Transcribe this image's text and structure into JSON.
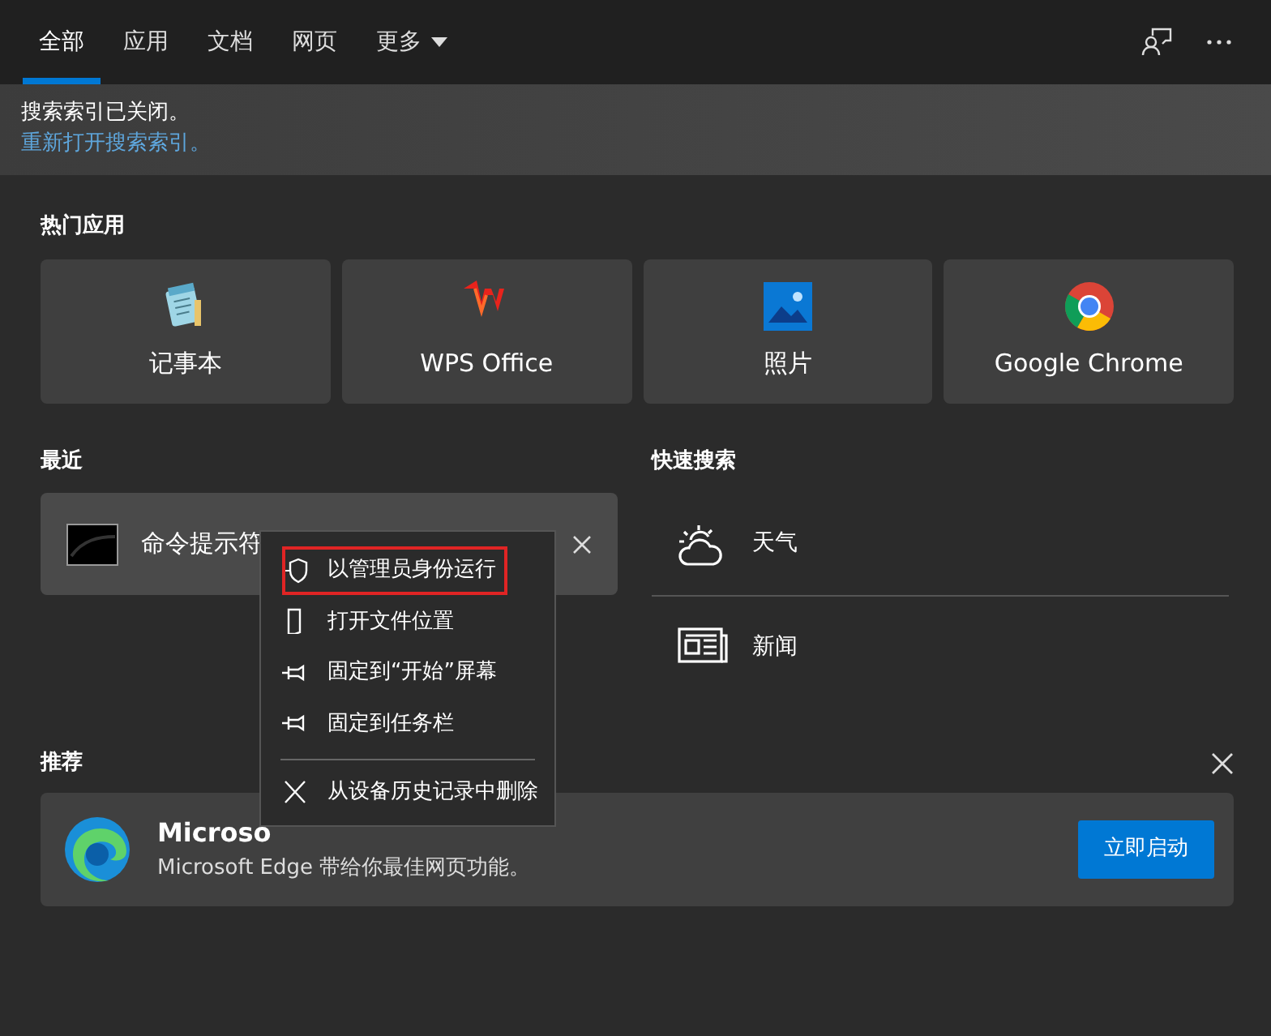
{
  "tabs": [
    {
      "label": "全部",
      "selected": true,
      "kind": "tab"
    },
    {
      "label": "应用",
      "selected": false,
      "kind": "tab"
    },
    {
      "label": "文档",
      "selected": false,
      "kind": "tab"
    },
    {
      "label": "网页",
      "selected": false,
      "kind": "tab"
    },
    {
      "label": "更多",
      "selected": false,
      "kind": "dropdown"
    }
  ],
  "notice": {
    "message": "搜索索引已关闭。",
    "link": "重新打开搜索索引。"
  },
  "top_apps": {
    "title": "热门应用",
    "items": [
      {
        "name": "记事本",
        "kind": "notepad"
      },
      {
        "name": "WPS Office",
        "kind": "wps"
      },
      {
        "name": "照片",
        "kind": "photos"
      },
      {
        "name": "Google Chrome",
        "kind": "chrome"
      }
    ]
  },
  "recent": {
    "title": "最近",
    "items": [
      {
        "name": "命令提示符",
        "kind": "cmd"
      }
    ]
  },
  "quick_search": {
    "title": "快速搜索",
    "items": [
      {
        "label": "天气",
        "kind": "weather"
      },
      {
        "label": "新闻",
        "kind": "news"
      }
    ]
  },
  "recommended": {
    "title": "推荐",
    "app_title": "Microso",
    "description": "Microsoft Edge 带给你最佳网页功能。",
    "button": "立即启动"
  },
  "context_menu": {
    "items": [
      {
        "label": "以管理员身份运行",
        "kind": "shield",
        "highlighted": true
      },
      {
        "label": "打开文件位置",
        "kind": "folder",
        "highlighted": false
      },
      {
        "label": "固定到“开始”屏幕",
        "kind": "pin",
        "highlighted": false
      },
      {
        "label": "固定到任务栏",
        "kind": "pin",
        "highlighted": false
      },
      {
        "label": "从设备历史记录中删除",
        "kind": "remove",
        "highlighted": false,
        "divider_before": true
      }
    ]
  }
}
